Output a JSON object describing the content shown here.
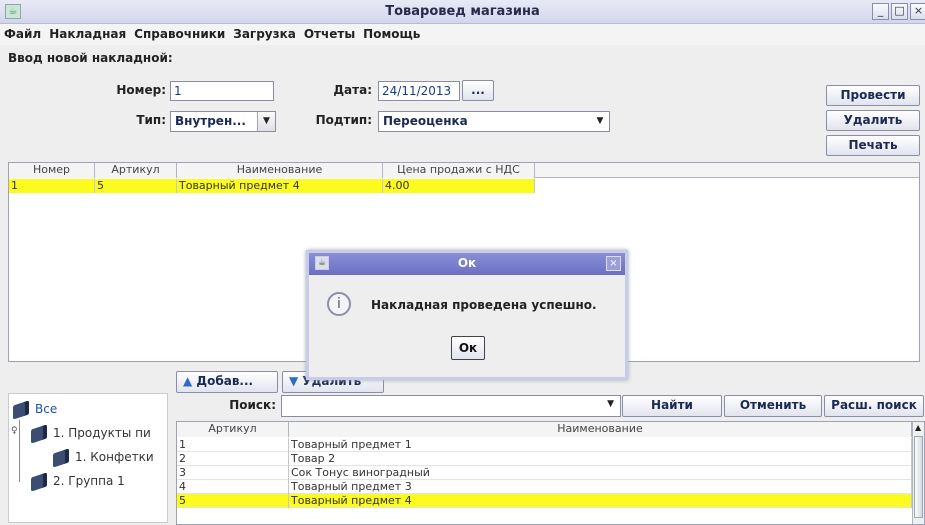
{
  "window": {
    "title": "Товаровед магазина"
  },
  "menu": [
    "Файл",
    "Накладная",
    "Справочники",
    "Загрузка",
    "Отчеты",
    "Помощь"
  ],
  "form": {
    "heading": "Ввод новой накладной:",
    "number_label": "Номер:",
    "number_value": "1",
    "date_label": "Дата:",
    "date_value": "24/11/2013",
    "date_button": "...",
    "type_label": "Тип:",
    "type_value": "Внутрен...",
    "subtype_label": "Подтип:",
    "subtype_value": "Переоценка"
  },
  "actions": {
    "post": "Провести",
    "delete": "Удалить",
    "print": "Печать"
  },
  "invoice_table": {
    "columns": [
      "Номер",
      "Артикул",
      "Наименование",
      "Цена продажи с НДС"
    ],
    "rows": [
      {
        "num": "1",
        "article": "5",
        "name": "Товарный предмет 4",
        "price": "4.00",
        "selected": true
      }
    ]
  },
  "dialog": {
    "title": "Ок",
    "message": "Накладная проведена успешно.",
    "ok": "Ок"
  },
  "midbar": {
    "add": "Добав...",
    "remove": "Удалить"
  },
  "tree": {
    "root": "Все",
    "items": [
      "1. Продукты пи",
      "1. Конфетки",
      "2. Группа 1"
    ]
  },
  "search": {
    "label": "Поиск:",
    "find": "Найти",
    "cancel": "Отменить",
    "advanced": "Расш. поиск"
  },
  "goods_table": {
    "columns": [
      "Артикул",
      "Наименование"
    ],
    "rows": [
      {
        "article": "1",
        "name": "Товарный предмет 1"
      },
      {
        "article": "2",
        "name": "Товар 2"
      },
      {
        "article": "3",
        "name": "Сок Тонус виноградный"
      },
      {
        "article": "4",
        "name": "Товарный предмет 3"
      },
      {
        "article": "5",
        "name": "Товарный предмет 4",
        "selected": true
      }
    ]
  },
  "colors": {
    "selection": "#fbfb20",
    "title_bar": "#d3d5ec",
    "dialog_title": "#6a6fc2"
  }
}
